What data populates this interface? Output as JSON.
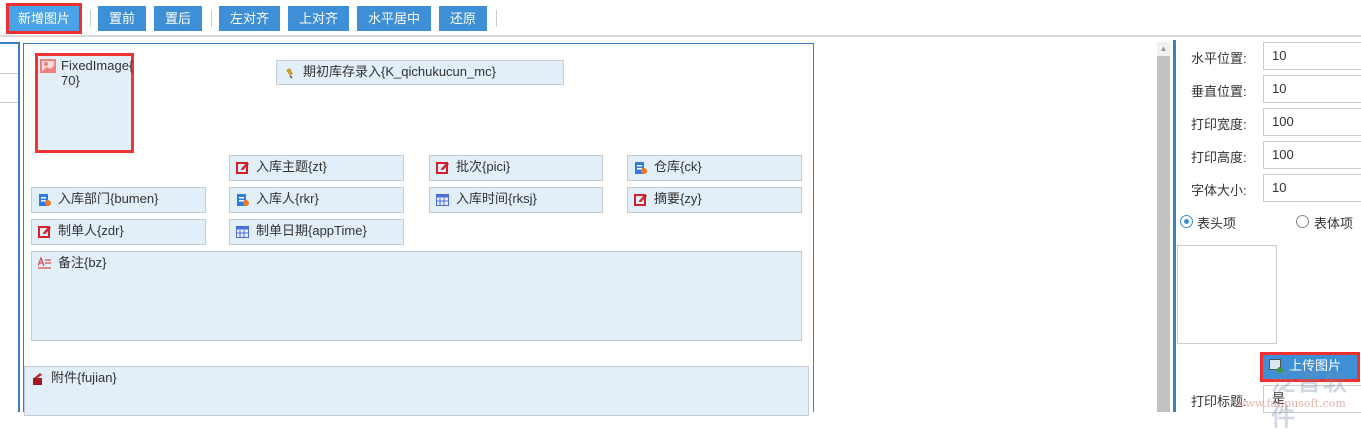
{
  "toolbar": {
    "buttons": [
      {
        "label": "新增图片",
        "selected": true
      },
      {
        "label": "置前"
      },
      {
        "label": "置后"
      },
      {
        "label": "左对齐"
      },
      {
        "label": "上对齐"
      },
      {
        "label": "水平居中"
      },
      {
        "label": "还原"
      }
    ]
  },
  "canvas": {
    "fixed_image": {
      "label": "FixedImage{70}",
      "line1": "FixedImage{",
      "line2": "70}"
    },
    "fields": [
      {
        "label": "期初库存录入{K_qichukucun_mc}",
        "icon": "pencil-icon"
      },
      {
        "label": "入库主题{zt}",
        "icon": "edit-icon"
      },
      {
        "label": "批次{pici}",
        "icon": "edit-icon"
      },
      {
        "label": "仓库{ck}",
        "icon": "select-icon"
      },
      {
        "label": "入库部门{bumen}",
        "icon": "select-icon"
      },
      {
        "label": "入库人{rkr}",
        "icon": "select-icon"
      },
      {
        "label": "入库时间{rksj}",
        "icon": "calendar-icon"
      },
      {
        "label": "摘要{zy}",
        "icon": "edit-icon"
      },
      {
        "label": "制单人{zdr}",
        "icon": "edit-icon"
      },
      {
        "label": "制单日期{appTime}",
        "icon": "calendar-icon"
      },
      {
        "label": "备注{bz}",
        "icon": "textarea-icon"
      },
      {
        "label": "附件{fujian}",
        "icon": "attachment-icon"
      }
    ]
  },
  "properties": {
    "rows": [
      {
        "label": "水平位置:",
        "value": "10"
      },
      {
        "label": "垂直位置:",
        "value": "10"
      },
      {
        "label": "打印宽度:",
        "value": "100"
      },
      {
        "label": "打印高度:",
        "value": "100"
      },
      {
        "label": "字体大小:",
        "value": "10"
      }
    ],
    "radio_header": "表头项",
    "radio_body": "表体项",
    "radio_selected": "表头项",
    "upload_button": "上传图片",
    "print_title_label": "打印标题:",
    "print_title_value": "是"
  },
  "watermark": {
    "text": "泛普软件",
    "url": "www.fanpusoft.com"
  }
}
